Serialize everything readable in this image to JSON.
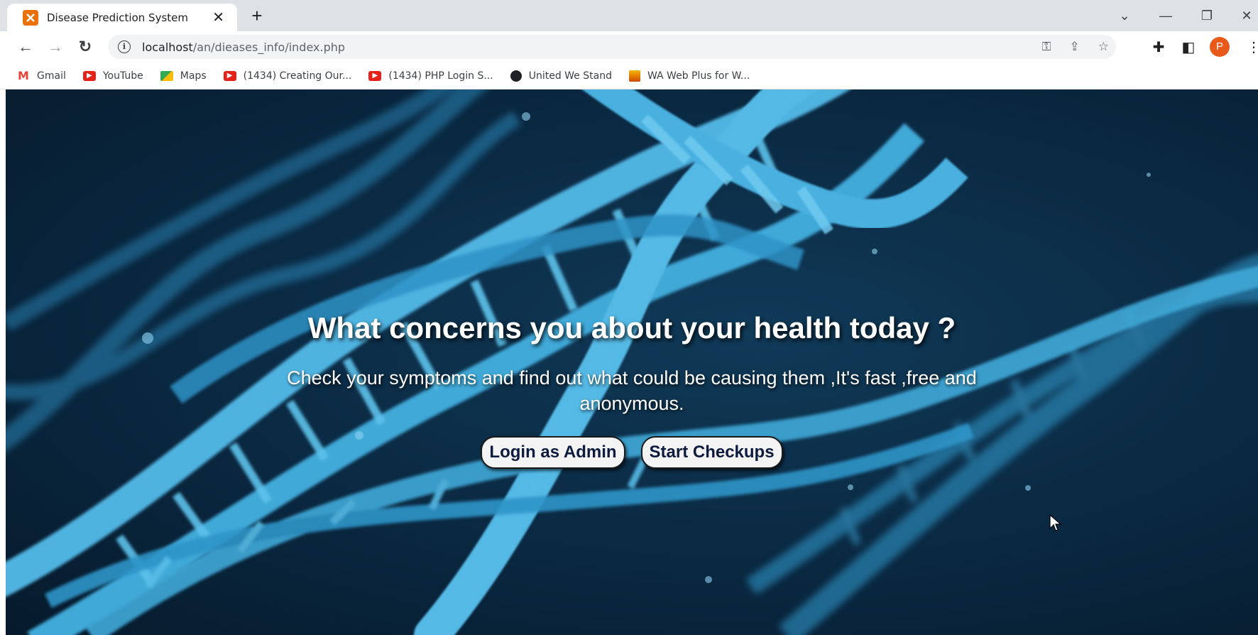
{
  "browser": {
    "tab": {
      "title": "Disease Prediction System"
    },
    "address": {
      "host": "localhost",
      "path": "/an/dieases_info/index.php"
    },
    "profile_initial": "P",
    "bookmarks": [
      {
        "label": "Gmail",
        "icon": "gmail-icon"
      },
      {
        "label": "YouTube",
        "icon": "youtube-icon"
      },
      {
        "label": "Maps",
        "icon": "maps-icon"
      },
      {
        "label": "(1434) Creating Our...",
        "icon": "youtube-icon"
      },
      {
        "label": "(1434) PHP Login S...",
        "icon": "youtube-icon"
      },
      {
        "label": "United We Stand",
        "icon": "globe-icon"
      },
      {
        "label": "WA Web Plus for W...",
        "icon": "wa-web-plus-icon"
      }
    ]
  },
  "hero": {
    "title": "What concerns you about your health today ?",
    "subtitle": "Check your symptoms and find out what could be causing them ,It's fast ,free and anonymous.",
    "buttons": {
      "admin": "Login as Admin",
      "checkups": "Start Checkups"
    }
  },
  "colors": {
    "background": "#0b2b45",
    "dna": "#3fa9d8",
    "button_bg": "#f4f4f4",
    "button_text": "#0d1b3e"
  }
}
